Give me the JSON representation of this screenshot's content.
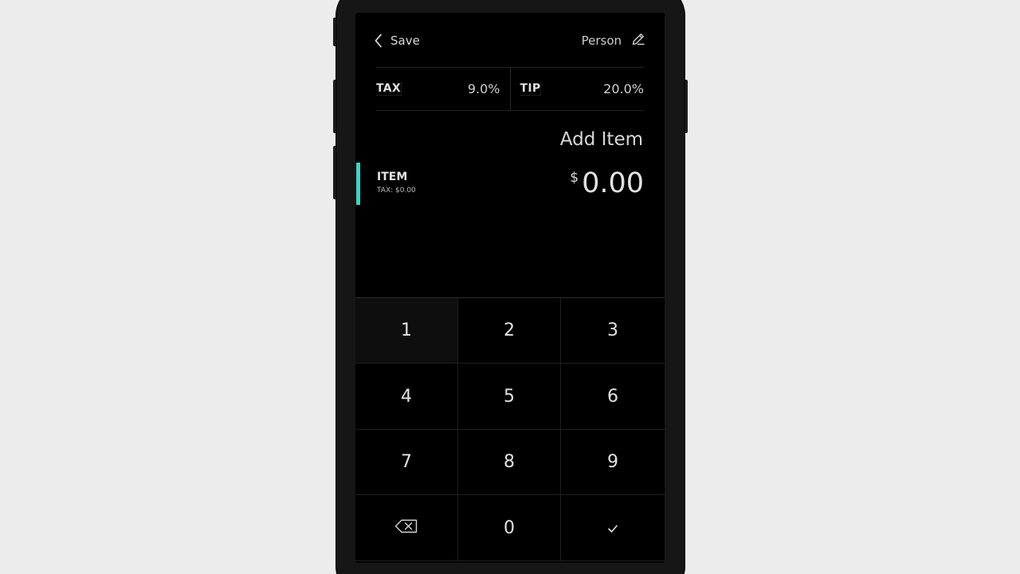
{
  "header": {
    "back_label": "Save",
    "back_icon": "chevron-left-icon",
    "person_label": "Person",
    "edit_icon": "pencil-icon"
  },
  "rates": {
    "tax_label": "TAX",
    "tax_value": "9.0%",
    "tip_label": "TIP",
    "tip_value": "20.0%"
  },
  "add_item_label": "Add Item",
  "item": {
    "name": "ITEM",
    "tax_text": "TAX: $0.00",
    "currency": "$",
    "amount": "0.00",
    "accent_color": "#39d6c6"
  },
  "keypad": {
    "keys": [
      "1",
      "2",
      "3",
      "4",
      "5",
      "6",
      "7",
      "8",
      "9",
      "",
      "0",
      ""
    ],
    "backspace_icon": "backspace-icon",
    "confirm_icon": "checkmark-icon"
  }
}
